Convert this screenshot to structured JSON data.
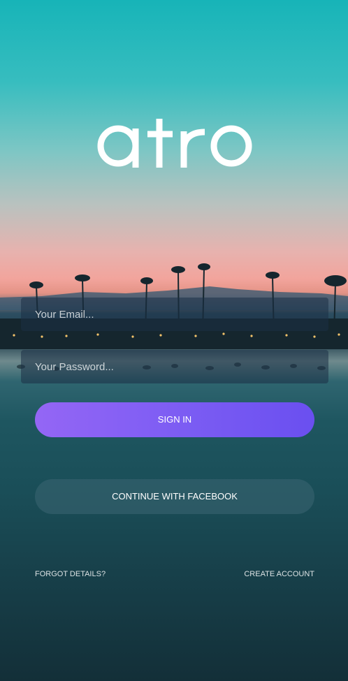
{
  "app": {
    "logo_text": "atro"
  },
  "form": {
    "email_placeholder": "Your Email...",
    "password_placeholder": "Your Password..."
  },
  "buttons": {
    "sign_in_label": "SIGN IN",
    "facebook_label": "CONTINUE WITH FACEBOOK"
  },
  "links": {
    "forgot_label": "FORGOT DETAILS?",
    "create_label": "CREATE ACCOUNT"
  },
  "colors": {
    "sign_in_gradient_start": "#9466f5",
    "sign_in_gradient_end": "#6a4ff0",
    "text": "#ffffff"
  }
}
